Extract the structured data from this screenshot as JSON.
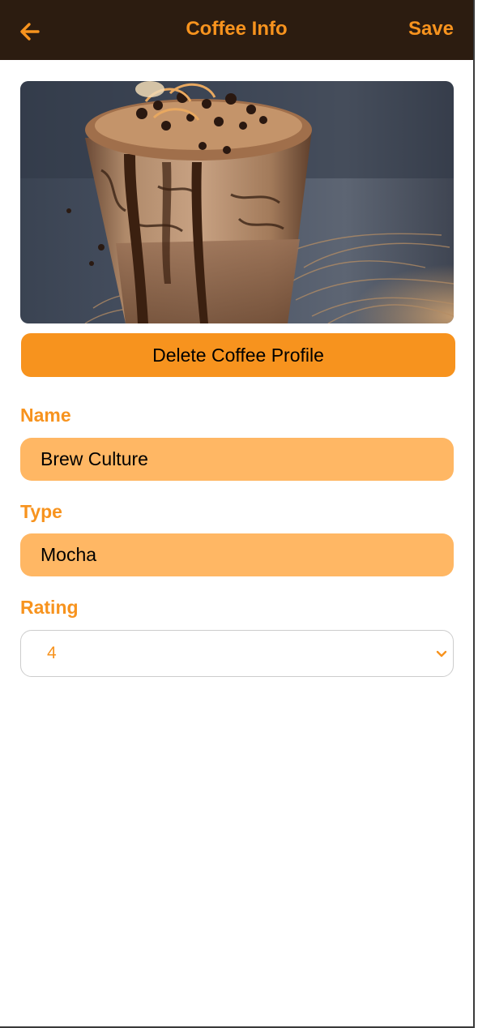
{
  "header": {
    "title": "Coffee Info",
    "save_label": "Save",
    "back_icon": "arrow-left-icon"
  },
  "photo": {
    "subject": "chocolate frappe drink"
  },
  "actions": {
    "delete_label": "Delete Coffee Profile"
  },
  "form": {
    "name_label": "Name",
    "name_value": "Brew Culture",
    "type_label": "Type",
    "type_value": "Mocha",
    "rating_label": "Rating",
    "rating_value": "4",
    "rating_icon": "chevron-down-icon"
  },
  "colors": {
    "header_bg": "#2c1c10",
    "accent": "#f7931e",
    "input_bg": "#ffb764"
  }
}
